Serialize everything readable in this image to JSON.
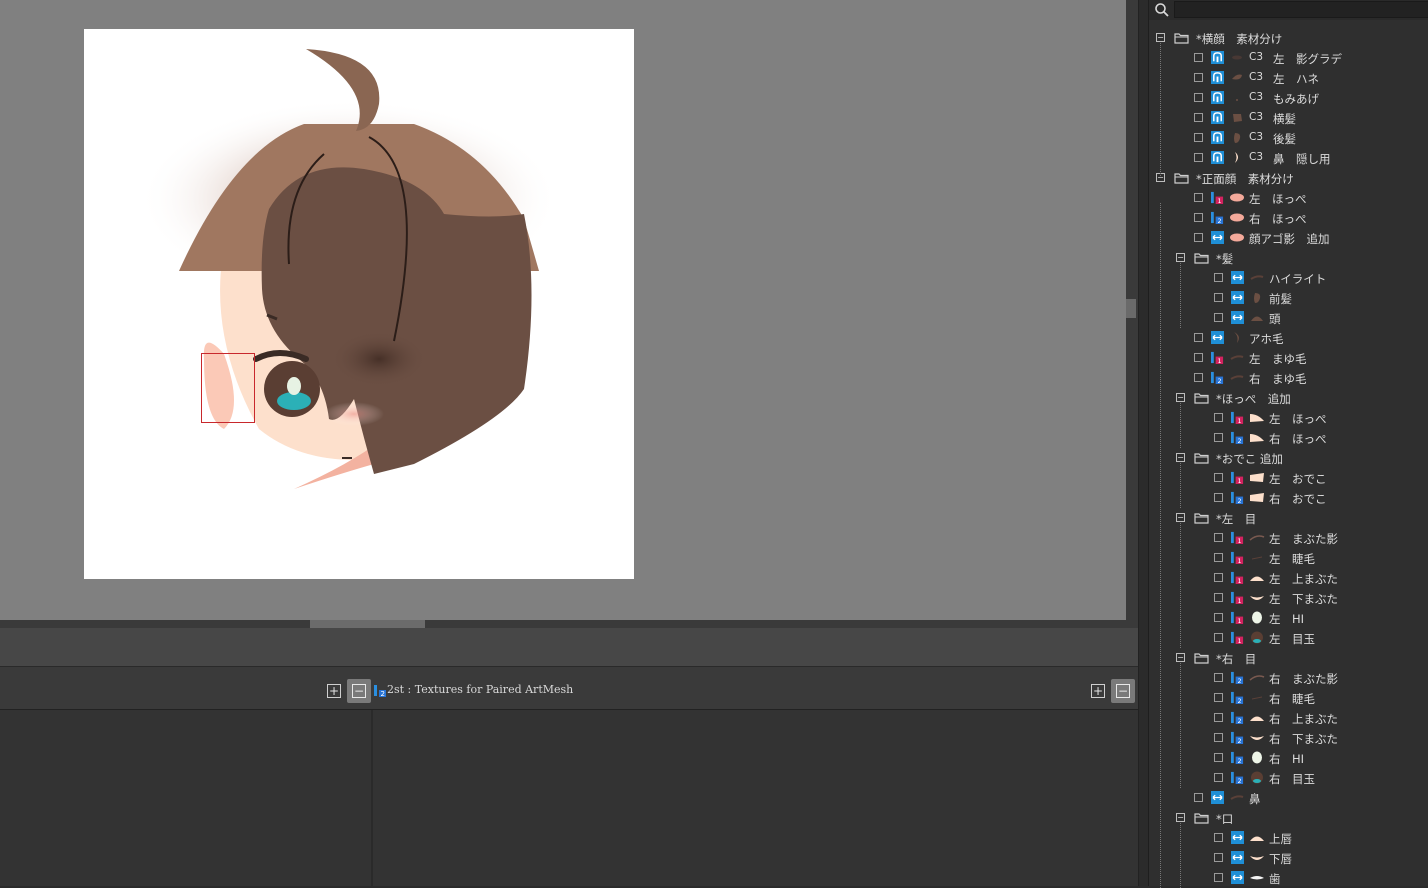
{
  "editor": {
    "lower_toolbar_title": "2st : Textures for Paired ArtMesh",
    "plus_label": "+",
    "minus_label": "−"
  },
  "search": {
    "placeholder": "",
    "value": ""
  },
  "colors": {
    "accent_blue": "#1f8fd6",
    "pair_badge_red": "#d2225f",
    "pair_badge_blue": "#2874d6",
    "hair_brown": "#6b4f43",
    "hair_light": "#a07760",
    "skin": "#fde0cc",
    "eye_teal": "#2bb0b7",
    "selection_box": "#c8282c"
  },
  "tree": [
    {
      "level": 0,
      "kind": "folder",
      "label": "*横顔　素材分け"
    },
    {
      "level": 1,
      "kind": "item",
      "type": "warp",
      "prefix": "C3",
      "label": "左　影グラデ",
      "thumb": "smudge"
    },
    {
      "level": 1,
      "kind": "item",
      "type": "warp",
      "prefix": "C3",
      "label": "左　ハネ",
      "thumb": "lock"
    },
    {
      "level": 1,
      "kind": "item",
      "type": "warp",
      "prefix": "C3",
      "label": "もみあげ",
      "thumb": "dot"
    },
    {
      "level": 1,
      "kind": "item",
      "type": "warp",
      "prefix": "C3",
      "label": "横髪",
      "thumb": "hair"
    },
    {
      "level": 1,
      "kind": "item",
      "type": "warp",
      "prefix": "C3",
      "label": "後髪",
      "thumb": "hair2"
    },
    {
      "level": 1,
      "kind": "item",
      "type": "warp",
      "prefix": "C3",
      "label": "鼻　隠し用",
      "thumb": "nose"
    },
    {
      "level": 0,
      "kind": "folder",
      "label": "*正面顔　素材分け"
    },
    {
      "level": 1,
      "kind": "item",
      "type": "pair1",
      "prefix": "",
      "label": "左　ほっぺ",
      "thumb": "cheek"
    },
    {
      "level": 1,
      "kind": "item",
      "type": "pair2",
      "prefix": "",
      "label": "右　ほっぺ",
      "thumb": "cheek"
    },
    {
      "level": 1,
      "kind": "item",
      "type": "mesh",
      "prefix": "",
      "label": "顔アゴ影　追加",
      "thumb": "cheek"
    },
    {
      "level": 1,
      "kind": "folder",
      "label": "*髪"
    },
    {
      "level": 2,
      "kind": "item",
      "type": "mesh",
      "prefix": "",
      "label": "ハイライト",
      "thumb": "brow"
    },
    {
      "level": 2,
      "kind": "item",
      "type": "mesh",
      "prefix": "",
      "label": "前髪",
      "thumb": "hair2"
    },
    {
      "level": 2,
      "kind": "item",
      "type": "mesh",
      "prefix": "",
      "label": "頭",
      "thumb": "head"
    },
    {
      "level": 1,
      "kind": "item",
      "type": "mesh",
      "prefix": "",
      "label": "アホ毛",
      "thumb": "ahoge"
    },
    {
      "level": 1,
      "kind": "item",
      "type": "pair1",
      "prefix": "",
      "label": "左　まゆ毛",
      "thumb": "brow"
    },
    {
      "level": 1,
      "kind": "item",
      "type": "pair2",
      "prefix": "",
      "label": "右　まゆ毛",
      "thumb": "brow"
    },
    {
      "level": 1,
      "kind": "folder",
      "label": "*ほっぺ　追加"
    },
    {
      "level": 2,
      "kind": "item",
      "type": "pair1",
      "prefix": "",
      "label": "左　ほっぺ",
      "thumb": "cheekshape"
    },
    {
      "level": 2,
      "kind": "item",
      "type": "pair2",
      "prefix": "",
      "label": "右　ほっぺ",
      "thumb": "cheekshape"
    },
    {
      "level": 1,
      "kind": "folder",
      "label": "*おでこ 追加"
    },
    {
      "level": 2,
      "kind": "item",
      "type": "pair1",
      "prefix": "",
      "label": "左　おでこ",
      "thumb": "forehead"
    },
    {
      "level": 2,
      "kind": "item",
      "type": "pair2",
      "prefix": "",
      "label": "右　おでこ",
      "thumb": "forehead"
    },
    {
      "level": 1,
      "kind": "folder",
      "label": "*左　目"
    },
    {
      "level": 2,
      "kind": "item",
      "type": "pair1",
      "prefix": "",
      "label": "左　まぶた影",
      "thumb": "lash"
    },
    {
      "level": 2,
      "kind": "item",
      "type": "pair1",
      "prefix": "",
      "label": "左　睫毛",
      "thumb": "lash2"
    },
    {
      "level": 2,
      "kind": "item",
      "type": "pair1",
      "prefix": "",
      "label": "左　上まぶた",
      "thumb": "lid"
    },
    {
      "level": 2,
      "kind": "item",
      "type": "pair1",
      "prefix": "",
      "label": "左　下まぶた",
      "thumb": "lowlid"
    },
    {
      "level": 2,
      "kind": "item",
      "type": "pair1",
      "prefix": "",
      "label": "左　HI",
      "thumb": "hi"
    },
    {
      "level": 2,
      "kind": "item",
      "type": "pair1",
      "prefix": "",
      "label": "左　目玉",
      "thumb": "eyeball"
    },
    {
      "level": 1,
      "kind": "folder",
      "label": "*右　目"
    },
    {
      "level": 2,
      "kind": "item",
      "type": "pair2",
      "prefix": "",
      "label": "右　まぶた影",
      "thumb": "lash"
    },
    {
      "level": 2,
      "kind": "item",
      "type": "pair2",
      "prefix": "",
      "label": "右　睫毛",
      "thumb": "lash2"
    },
    {
      "level": 2,
      "kind": "item",
      "type": "pair2",
      "prefix": "",
      "label": "右　上まぶた",
      "thumb": "lid"
    },
    {
      "level": 2,
      "kind": "item",
      "type": "pair2",
      "prefix": "",
      "label": "右　下まぶた",
      "thumb": "lowlid"
    },
    {
      "level": 2,
      "kind": "item",
      "type": "pair2",
      "prefix": "",
      "label": "右　HI",
      "thumb": "hi"
    },
    {
      "level": 2,
      "kind": "item",
      "type": "pair2",
      "prefix": "",
      "label": "右　目玉",
      "thumb": "eyeball"
    },
    {
      "level": 1,
      "kind": "item",
      "type": "mesh",
      "prefix": "",
      "label": "鼻",
      "thumb": "brow"
    },
    {
      "level": 1,
      "kind": "folder",
      "label": "*口"
    },
    {
      "level": 2,
      "kind": "item",
      "type": "mesh",
      "prefix": "",
      "label": "上唇",
      "thumb": "lid"
    },
    {
      "level": 2,
      "kind": "item",
      "type": "mesh",
      "prefix": "",
      "label": "下唇",
      "thumb": "lowlid"
    },
    {
      "level": 2,
      "kind": "item",
      "type": "mesh",
      "prefix": "",
      "label": "歯",
      "thumb": "teeth"
    }
  ]
}
